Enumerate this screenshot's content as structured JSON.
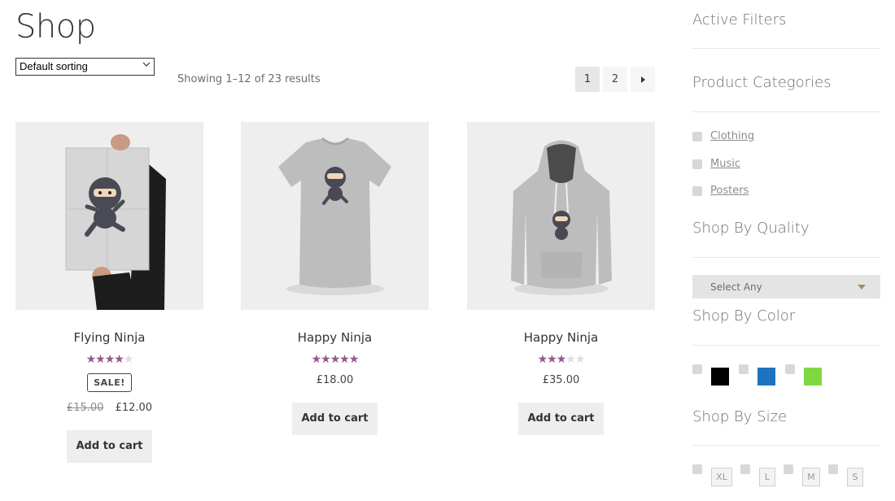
{
  "page": {
    "title": "Shop",
    "sorting": "Default sorting",
    "result_count": "Showing 1–12 of 23 results"
  },
  "pagination": {
    "pages": [
      "1",
      "2"
    ],
    "current": "1",
    "next_icon": "next-arrow-icon"
  },
  "products": [
    {
      "title": "Flying Ninja",
      "rating": 4,
      "rating_max": 5,
      "sale_badge": "SALE!",
      "regular_price": "£15.00",
      "price": "£12.00",
      "button": "Add to cart"
    },
    {
      "title": "Happy Ninja",
      "rating": 5,
      "rating_max": 5,
      "price": "£18.00",
      "button": "Add to cart"
    },
    {
      "title": "Happy Ninja",
      "rating": 3,
      "rating_max": 5,
      "price": "£35.00",
      "button": "Add to cart"
    }
  ],
  "sidebar": {
    "active_filters_title": "Active Filters",
    "categories_title": "Product Categories",
    "categories": [
      "Clothing",
      "Music",
      "Posters"
    ],
    "quality_title": "Shop By Quality",
    "quality_select": "Select Any",
    "color_title": "Shop By Color",
    "colors": [
      "#000000",
      "#1e73be",
      "#81d742"
    ],
    "size_title": "Shop By Size",
    "sizes": [
      "XL",
      "L",
      "M",
      "S"
    ]
  },
  "colors": {
    "star": "#96588a",
    "star_empty": "#e3d8e4",
    "button_bg": "#eeeeee"
  }
}
